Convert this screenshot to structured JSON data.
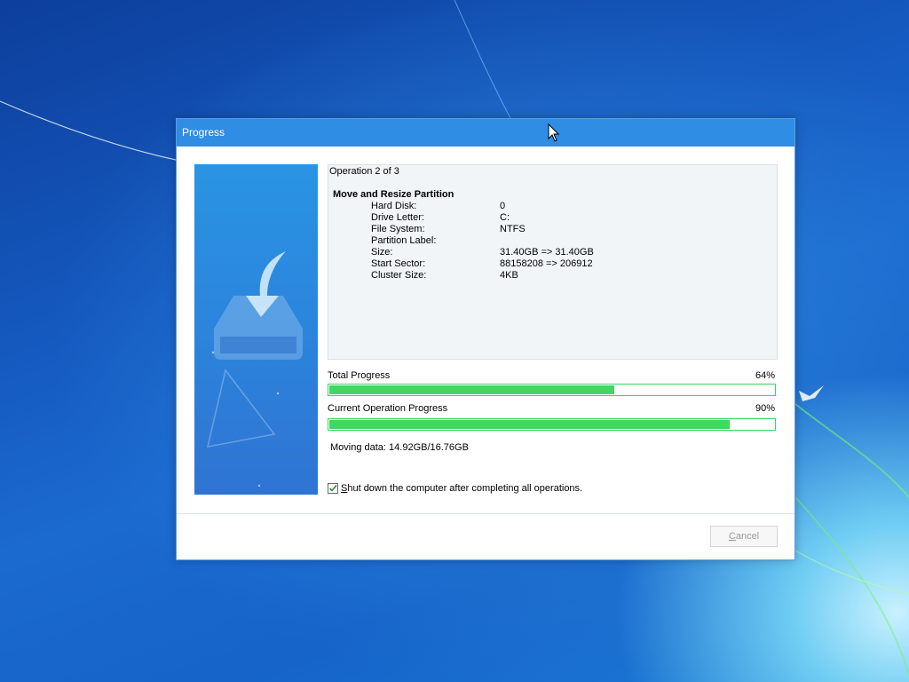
{
  "dialog": {
    "title": "Progress",
    "operation_counter": "Operation 2 of 3",
    "operation_title": "Move and Resize Partition",
    "details": [
      {
        "label": "Hard Disk:",
        "value": "0"
      },
      {
        "label": "Drive Letter:",
        "value": "C:"
      },
      {
        "label": "File System:",
        "value": "NTFS"
      },
      {
        "label": "Partition Label:",
        "value": ""
      },
      {
        "label": "Size:",
        "value": "31.40GB => 31.40GB"
      },
      {
        "label": "Start Sector:",
        "value": "88158208 => 206912"
      },
      {
        "label": "Cluster Size:",
        "value": "4KB"
      }
    ],
    "total_progress": {
      "label": "Total Progress",
      "percent_text": "64%",
      "value": 0.64
    },
    "current_progress": {
      "label": "Current Operation Progress",
      "percent_text": "90%",
      "value": 0.9
    },
    "moving_data": "Moving data: 14.92GB/16.76GB",
    "shutdown_checkbox": {
      "checked": true,
      "label_first": "S",
      "label_rest": "hut down the computer after completing all operations."
    },
    "cancel_button": {
      "label_first": "C",
      "label_rest": "ancel",
      "enabled": false
    }
  },
  "colors": {
    "titlebar": "#2f8de4",
    "progress_fill": "#40d863",
    "progress_border": "#3fd160",
    "side_panel": "#2b86dd"
  },
  "icons": {
    "side_panel": "download-to-drive-icon",
    "cursor": "mouse-pointer-icon",
    "checkbox": "checkmark-icon"
  }
}
